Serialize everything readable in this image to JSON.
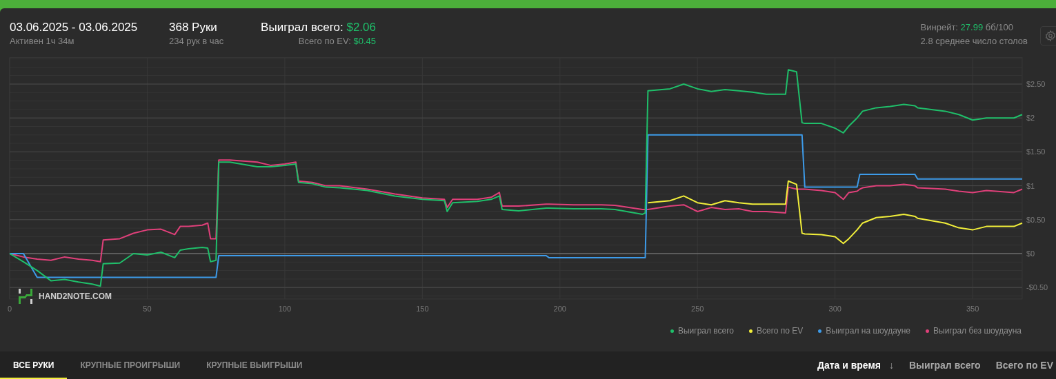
{
  "header": {
    "date_range": "03.06.2025 - 03.06.2025",
    "active": "Активен 1ч 34м",
    "hands": "368 Руки",
    "hands_per_hour": "234 рук в час",
    "won_label": "Выиграл всего:",
    "won_value": "$2.06",
    "ev_label": "Всего по EV:",
    "ev_value": "$0.45",
    "winrate_label": "Винрейт:",
    "winrate_value": "27.99",
    "winrate_unit": "бб/100",
    "tables": "2.8 среднее число столов"
  },
  "chart": {
    "watermark": "HAND2NOTE.COM",
    "chart_data": {
      "type": "line",
      "grid": true,
      "xlim": [
        0,
        368
      ],
      "ylim": [
        -0.67,
        2.89
      ],
      "xticks": [
        0,
        50,
        100,
        150,
        200,
        250,
        300,
        350
      ],
      "yticks": [
        {
          "value": 2.5,
          "label": "$2.50"
        },
        {
          "value": 2,
          "label": "$2"
        },
        {
          "value": 1.5,
          "label": "$1.50"
        },
        {
          "value": 1,
          "label": "$1"
        },
        {
          "value": 0.5,
          "label": "$0.50"
        },
        {
          "value": 0,
          "label": "$0"
        },
        {
          "value": -0.5,
          "label": "-$0.50"
        }
      ],
      "x": [
        0,
        5,
        10,
        15,
        20,
        25,
        30,
        33,
        34,
        40,
        45,
        50,
        55,
        60,
        62,
        65,
        70,
        72,
        73,
        75,
        76,
        80,
        90,
        95,
        100,
        104,
        105,
        110,
        115,
        120,
        130,
        140,
        150,
        158,
        159,
        161,
        170,
        175,
        178,
        179,
        185,
        195,
        196,
        205,
        215,
        220,
        230,
        231,
        232,
        240,
        245,
        250,
        255,
        260,
        265,
        270,
        275,
        282,
        283,
        286,
        288,
        289,
        295,
        300,
        303,
        305,
        308,
        309,
        310,
        315,
        320,
        325,
        329,
        330,
        340,
        345,
        350,
        355,
        365,
        368
      ],
      "series": [
        {
          "name": "Выиграл без шоудауна",
          "color": "#e0407a",
          "values": [
            0,
            -0.05,
            -0.08,
            -0.1,
            -0.05,
            -0.08,
            -0.1,
            -0.12,
            0.2,
            0.22,
            0.3,
            0.35,
            0.36,
            0.28,
            0.4,
            0.4,
            0.42,
            0.45,
            0.22,
            0.22,
            1.38,
            1.38,
            1.35,
            1.3,
            1.32,
            1.35,
            1.07,
            1.05,
            1.0,
            1.0,
            0.95,
            0.88,
            0.82,
            0.8,
            0.68,
            0.8,
            0.8,
            0.83,
            0.9,
            0.7,
            0.7,
            0.73,
            0.73,
            0.72,
            0.72,
            0.71,
            0.65,
            0.65,
            0.65,
            0.7,
            0.72,
            0.62,
            0.68,
            0.65,
            0.66,
            0.62,
            0.62,
            0.6,
            0.98,
            0.95,
            0.95,
            0.95,
            0.93,
            0.9,
            0.8,
            0.9,
            0.92,
            0.95,
            0.97,
            1.0,
            1.0,
            1.02,
            1.0,
            0.97,
            0.95,
            0.92,
            0.9,
            0.93,
            0.9,
            0.95
          ]
        },
        {
          "name": "Выиграл на шоудауне",
          "color": "#3d9be9",
          "values": [
            0,
            0,
            -0.35,
            -0.35,
            -0.35,
            -0.35,
            -0.35,
            -0.35,
            -0.35,
            -0.35,
            -0.35,
            -0.35,
            -0.35,
            -0.35,
            -0.35,
            -0.35,
            -0.35,
            -0.35,
            -0.35,
            -0.35,
            -0.03,
            -0.03,
            -0.03,
            -0.03,
            -0.03,
            -0.03,
            -0.03,
            -0.03,
            -0.03,
            -0.03,
            -0.03,
            -0.03,
            -0.03,
            -0.03,
            -0.03,
            -0.03,
            -0.03,
            -0.03,
            -0.03,
            -0.03,
            -0.03,
            -0.03,
            -0.06,
            -0.06,
            -0.06,
            -0.06,
            -0.06,
            -0.06,
            1.75,
            1.75,
            1.75,
            1.75,
            1.75,
            1.75,
            1.75,
            1.75,
            1.75,
            1.75,
            1.75,
            1.75,
            1.75,
            0.98,
            0.98,
            0.98,
            0.98,
            0.98,
            0.98,
            1.17,
            1.17,
            1.17,
            1.17,
            1.17,
            1.17,
            1.1,
            1.1,
            1.1,
            1.1,
            1.1,
            1.1,
            1.1
          ]
        },
        {
          "name": "Всего по EV",
          "color": "#f2ef3a",
          "values": [
            null,
            null,
            null,
            null,
            null,
            null,
            null,
            null,
            null,
            null,
            null,
            null,
            null,
            null,
            null,
            null,
            null,
            null,
            null,
            null,
            null,
            null,
            null,
            null,
            null,
            null,
            null,
            null,
            null,
            null,
            null,
            null,
            null,
            null,
            null,
            null,
            null,
            null,
            null,
            null,
            null,
            null,
            null,
            null,
            null,
            null,
            null,
            null,
            0.75,
            0.78,
            0.85,
            0.75,
            0.72,
            0.78,
            0.75,
            0.73,
            0.73,
            0.73,
            1.07,
            1.02,
            0.3,
            0.29,
            0.28,
            0.25,
            0.15,
            0.22,
            0.35,
            0.4,
            0.45,
            0.53,
            0.55,
            0.58,
            0.55,
            0.52,
            0.45,
            0.38,
            0.35,
            0.4,
            0.4,
            0.45
          ]
        },
        {
          "name": "Выиграл всего",
          "color": "#1fbf6a",
          "values": [
            0,
            -0.12,
            -0.25,
            -0.4,
            -0.38,
            -0.42,
            -0.45,
            -0.48,
            -0.15,
            -0.14,
            0.0,
            -0.02,
            0.02,
            -0.06,
            0.05,
            0.07,
            0.09,
            0.08,
            -0.12,
            -0.1,
            1.35,
            1.35,
            1.28,
            1.28,
            1.3,
            1.32,
            1.05,
            1.03,
            0.98,
            0.97,
            0.93,
            0.85,
            0.8,
            0.78,
            0.62,
            0.75,
            0.77,
            0.8,
            0.85,
            0.65,
            0.63,
            0.67,
            0.67,
            0.66,
            0.66,
            0.65,
            0.58,
            0.6,
            2.4,
            2.43,
            2.5,
            2.43,
            2.39,
            2.42,
            2.4,
            2.38,
            2.35,
            2.35,
            2.71,
            2.68,
            1.93,
            1.92,
            1.92,
            1.85,
            1.78,
            1.88,
            2.0,
            2.05,
            2.1,
            2.15,
            2.17,
            2.2,
            2.18,
            2.15,
            2.1,
            2.05,
            1.97,
            2.0,
            2.0,
            2.05
          ]
        }
      ]
    }
  },
  "tabs": [
    {
      "label": "ВСЕ РУКИ",
      "selected": true
    },
    {
      "label": "КРУПНЫЕ ПРОИГРЫШИ",
      "selected": false
    },
    {
      "label": "КРУПНЫЕ ВЫИГРЫШИ",
      "selected": false
    }
  ],
  "sort_columns": [
    {
      "label": "Дата и время",
      "selected": true,
      "sort_arrow": "↓"
    },
    {
      "label": "Выиграл всего",
      "selected": false
    },
    {
      "label": "Всего по EV",
      "selected": false
    }
  ]
}
